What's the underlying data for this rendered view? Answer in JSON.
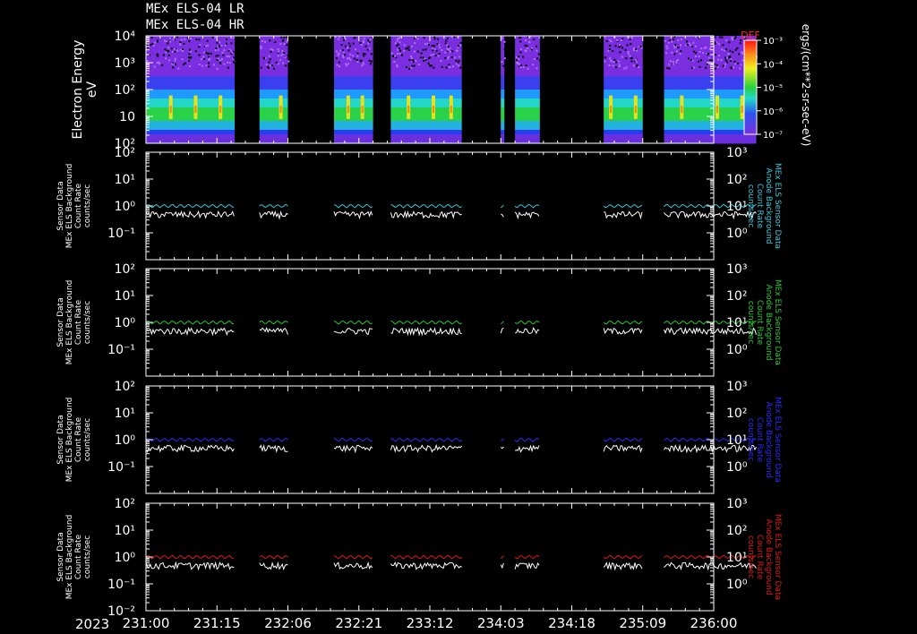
{
  "header": {
    "line1": "MEx ELS-04 LR",
    "line2": "MEx ELS-04 HR"
  },
  "year": "2023",
  "colors": {
    "background": "#000000",
    "axis": "#ffffff",
    "panel1": "#34c8d8",
    "panel2": "#28c832",
    "panel3": "#2a2aff",
    "panel4": "#e21818",
    "secondary": "#ffffff"
  },
  "chart_data": [
    {
      "type": "heatmap",
      "id": "spectrogram",
      "ylabel_lines": [
        "Electron Energy",
        "eV"
      ],
      "yscale": "log",
      "ylim": [
        1,
        10000
      ],
      "y_ticks": [
        {
          "value": 10,
          "label": "10"
        },
        {
          "value": 100,
          "label": "10²"
        },
        {
          "value": 1000,
          "label": "10³"
        },
        {
          "value": 10000,
          "label": "10⁴"
        }
      ],
      "colorbar": {
        "title": "DEF",
        "scale": "log",
        "range": [
          1e-07,
          0.001
        ],
        "ticks": [
          "10⁻³",
          "10⁻⁴",
          "10⁻⁵",
          "10⁻⁶",
          "10⁻⁷"
        ],
        "label": "ergs/(cm**2-sr-sec-eV)"
      },
      "x_ticks": [
        "231:00",
        "231:15",
        "232:06",
        "232:21",
        "233:12",
        "234:03",
        "234:18",
        "235:09",
        "236:00"
      ],
      "data_segments_x": [
        [
          0.0,
          1.25
        ],
        [
          1.6,
          2.0
        ],
        [
          2.65,
          3.2
        ],
        [
          3.45,
          4.45
        ],
        [
          5.0,
          5.05
        ],
        [
          5.2,
          5.55
        ],
        [
          6.45,
          7.0
        ],
        [
          7.3,
          8.6
        ]
      ],
      "data_gaps_x": [
        [
          1.25,
          1.6
        ],
        [
          2.0,
          2.65
        ],
        [
          3.2,
          3.45
        ],
        [
          4.45,
          5.0
        ],
        [
          5.05,
          5.2
        ],
        [
          5.55,
          6.45
        ],
        [
          7.0,
          7.3
        ]
      ],
      "peak_energy_ev": 12,
      "burst_x": [
        0.35,
        0.7,
        1.05,
        1.9,
        2.85,
        3.05,
        3.7,
        4.05,
        4.3,
        6.55,
        6.9,
        7.55,
        8.05,
        8.4
      ]
    },
    {
      "type": "line",
      "id": "panel1",
      "ylabel_lines": [
        "Sensor Data",
        "MEx ELS Background",
        "Count Rate",
        "counts/sec"
      ],
      "right_label_lines": [
        "MEx ELS Sensor Data",
        "Anode Background",
        "Count Rate",
        "counts/sec"
      ],
      "yscale": "log",
      "ylim": [
        0.01,
        100
      ],
      "y_ticks": [
        "10⁻¹",
        "10⁰",
        "10¹",
        "10²"
      ],
      "right_ylim": [
        0.1,
        1000
      ],
      "right_y_ticks": [
        "10⁰",
        "10¹",
        "10²",
        "10³"
      ],
      "series": [
        {
          "color": "cyan",
          "level": 1.0
        },
        {
          "color": "white",
          "level": 0.6
        }
      ]
    },
    {
      "type": "line",
      "id": "panel2",
      "ylabel_lines": [
        "Sensor Data",
        "MEx ELS Background",
        "Count Rate",
        "counts/sec"
      ],
      "right_label_lines": [
        "MEx ELS Sensor Data",
        "Anode Background",
        "Count Rate",
        "counts/sec"
      ],
      "yscale": "log",
      "ylim": [
        0.01,
        100
      ],
      "y_ticks": [
        "10⁻¹",
        "10⁰",
        "10¹",
        "10²"
      ],
      "right_ylim": [
        0.1,
        1000
      ],
      "right_y_ticks": [
        "10⁰",
        "10¹",
        "10²",
        "10³"
      ],
      "series": [
        {
          "color": "green",
          "level": 1.0
        },
        {
          "color": "white",
          "level": 0.6
        }
      ]
    },
    {
      "type": "line",
      "id": "panel3",
      "ylabel_lines": [
        "Sensor Data",
        "MEx ELS Background",
        "Count Rate",
        "counts/sec"
      ],
      "right_label_lines": [
        "MEx ELS Sensor Data",
        "Anode Background",
        "Count Rate",
        "counts/sec"
      ],
      "yscale": "log",
      "ylim": [
        0.01,
        100
      ],
      "y_ticks": [
        "10⁻¹",
        "10⁰",
        "10¹",
        "10²"
      ],
      "right_ylim": [
        0.1,
        1000
      ],
      "right_y_ticks": [
        "10⁰",
        "10¹",
        "10²",
        "10³"
      ],
      "series": [
        {
          "color": "blue",
          "level": 1.0
        },
        {
          "color": "white",
          "level": 0.6
        }
      ]
    },
    {
      "type": "line",
      "id": "panel4",
      "ylabel_lines": [
        "Sensor Data",
        "MEx ELS Background",
        "Count Rate",
        "counts/sec"
      ],
      "right_label_lines": [
        "MEx ELS Sensor Data",
        "Anode Background",
        "Count Rate",
        "counts/sec"
      ],
      "yscale": "log",
      "ylim": [
        0.01,
        100
      ],
      "y_ticks": [
        "10⁻²",
        "10⁻¹",
        "10⁰",
        "10¹",
        "10²"
      ],
      "right_ylim": [
        0.1,
        1000
      ],
      "right_y_ticks": [
        "10⁰",
        "10¹",
        "10²",
        "10³"
      ],
      "series": [
        {
          "color": "red",
          "level": 1.0
        },
        {
          "color": "white",
          "level": 0.6
        }
      ]
    }
  ]
}
